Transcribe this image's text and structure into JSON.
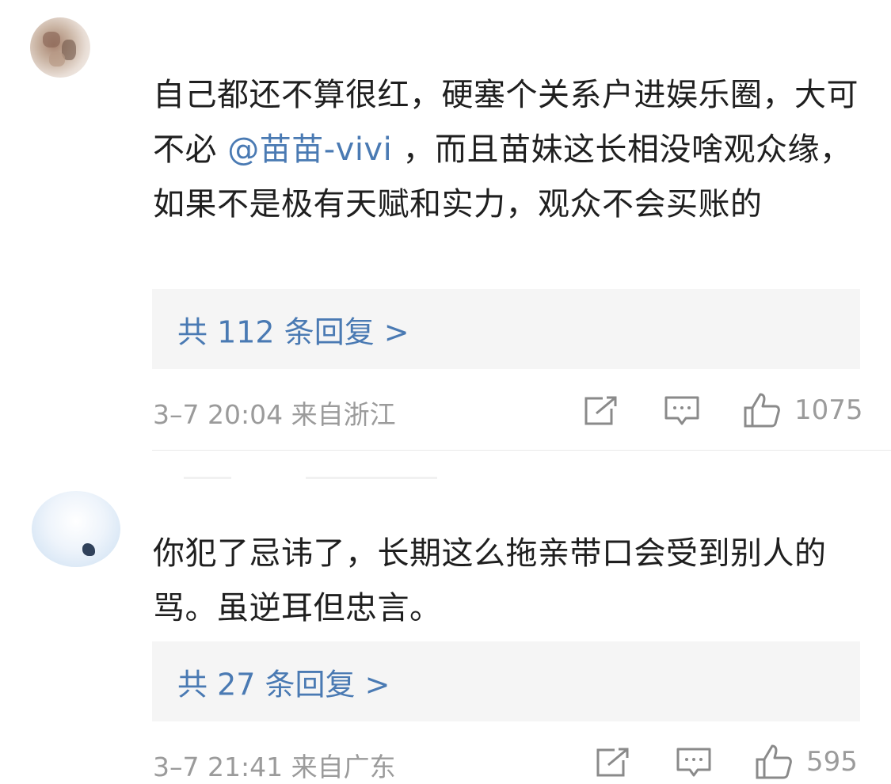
{
  "comments": [
    {
      "text_before": "自己都还不算很红，硬塞个关系户进娱乐圈，大可不必 ",
      "mention": "@苗苗-vivi",
      "text_after": " ，而且苗妹这长相没啥观众缘，如果不是极有天赋和实力，观众不会买账的",
      "replies_label": "共 112 条回复 >",
      "meta": "3–7 20:04  来自浙江",
      "likes": "1075"
    },
    {
      "text": "你犯了忌讳了，长期这么拖亲带口会受到别人的骂。虽逆耳但忠言。",
      "replies_label": "共 27 条回复 >",
      "meta": "3–7 21:41  来自广东",
      "likes": "595"
    }
  ],
  "icons": {
    "share": "share-icon",
    "comment": "comment-icon",
    "like": "thumbs-up-icon"
  },
  "colors": {
    "link": "#4a7ab3",
    "meta": "#9b9b9b",
    "reply_bg": "#f5f5f5"
  }
}
